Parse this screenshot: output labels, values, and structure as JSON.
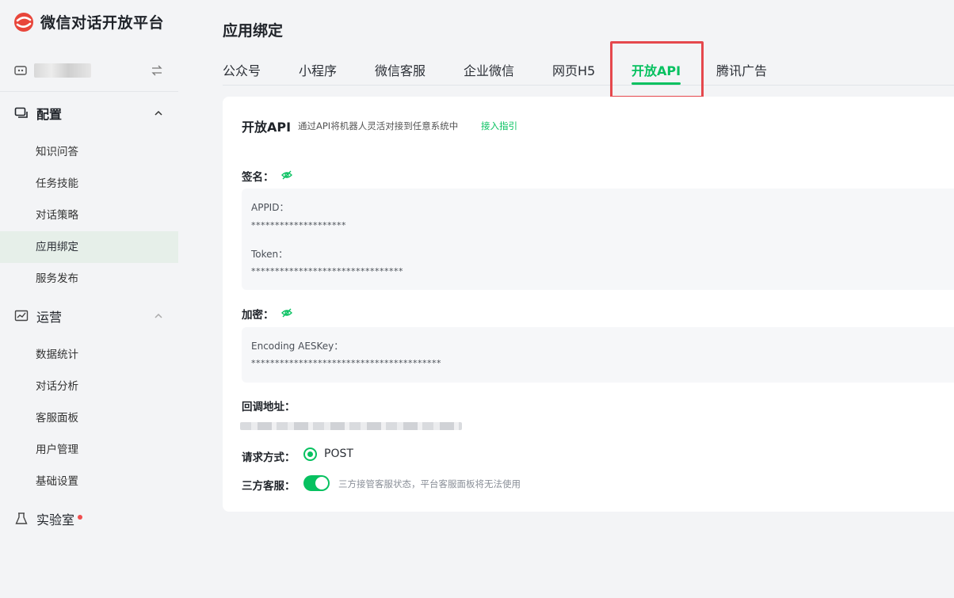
{
  "brand": {
    "title": "微信对话开放平台"
  },
  "sidebar": {
    "group_config": {
      "label": "配置",
      "items": [
        "知识问答",
        "任务技能",
        "对话策略",
        "应用绑定",
        "服务发布"
      ],
      "active_index": 3
    },
    "group_ops": {
      "label": "运营",
      "items": [
        "数据统计",
        "对话分析",
        "客服面板",
        "用户管理",
        "基础设置"
      ]
    },
    "lab": {
      "label": "实验室"
    }
  },
  "main": {
    "title": "应用绑定",
    "tabs": [
      "公众号",
      "小程序",
      "微信客服",
      "企业微信",
      "网页H5",
      "开放API",
      "腾讯广告"
    ],
    "active_tab": "开放API"
  },
  "card": {
    "title": "开放API",
    "desc": "通过API将机器人灵活对接到任意系统中",
    "link": "接入指引",
    "signature_label": "签名：",
    "appid_label": "APPID：",
    "appid_value": "********************",
    "token_label": "Token：",
    "token_value": "********************************",
    "encrypt_label": "加密：",
    "aeskey_label": "Encoding AESKey：",
    "aeskey_value": "****************************************",
    "callback_label": "回调地址：",
    "method_label": "请求方式：",
    "method_value": "POST",
    "third_party_label": "三方客服：",
    "third_party_note": "三方接管客服状态，平台客服面板将无法使用"
  },
  "colors": {
    "accent": "#07c160",
    "highlight": "#e5484d",
    "active_bg": "#e6efe9"
  }
}
